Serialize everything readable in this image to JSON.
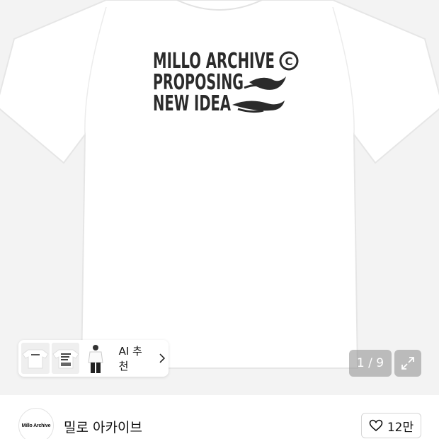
{
  "product_image": {
    "print_lines": [
      "MILLO ARCHIVE",
      "PROPOSING",
      "NEW IDEA"
    ],
    "copyright_glyph": "C",
    "shirt_color": "#ffffff",
    "print_color": "#2b2b2b"
  },
  "ai_recommendation": {
    "label": "AI 추천",
    "icon": "chevron-right-icon"
  },
  "gallery": {
    "pager_text": "1 / 9",
    "expand_icon": "expand-arrows-icon"
  },
  "brand": {
    "logo_text": "Millo Archive",
    "name": "밀로 아카이브",
    "like_icon": "heart-outline-icon",
    "like_count": "12만"
  }
}
